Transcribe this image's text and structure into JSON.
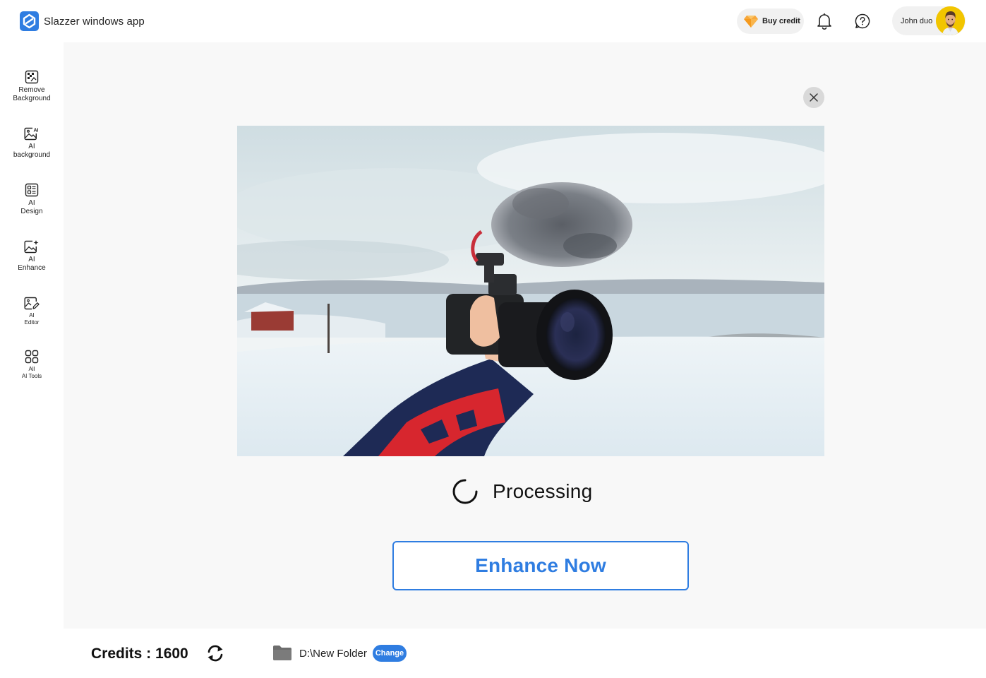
{
  "app": {
    "title": "Slazzer windows app",
    "logo_icon": "slazzer-logo-icon",
    "accent_color": "#2f7de1"
  },
  "header": {
    "buy_credit_label": "Buy credit",
    "buy_credit_icon": "diamond-icon",
    "notification_icon": "bell-icon",
    "help_icon": "help-question-icon",
    "user": {
      "name": "John duo",
      "avatar_icon": "avatar"
    }
  },
  "sidebar": {
    "items": [
      {
        "label": "Remove\nBackground",
        "icon": "remove-background-icon"
      },
      {
        "label": "AI\nbackground",
        "icon": "ai-background-icon"
      },
      {
        "label": "AI\nDesign",
        "icon": "ai-design-icon"
      },
      {
        "label": "AI\nEnhance",
        "icon": "ai-enhance-icon"
      },
      {
        "label": "AI\nEditor",
        "icon": "ai-editor-icon"
      },
      {
        "label": "All\nAI Tools",
        "icon": "grid-icon"
      }
    ]
  },
  "main": {
    "close_icon": "close-icon",
    "image_alt": "hand holding camera with microphone in snowy landscape",
    "status_text": "Processing",
    "status_icon": "spinner-icon",
    "action_label": "Enhance Now"
  },
  "footer": {
    "credits_text": "Credits : 1600",
    "sync_icon": "sync-icon",
    "folder_icon": "folder-icon",
    "folder_path": "D:\\New Folder",
    "change_label": "Change"
  }
}
